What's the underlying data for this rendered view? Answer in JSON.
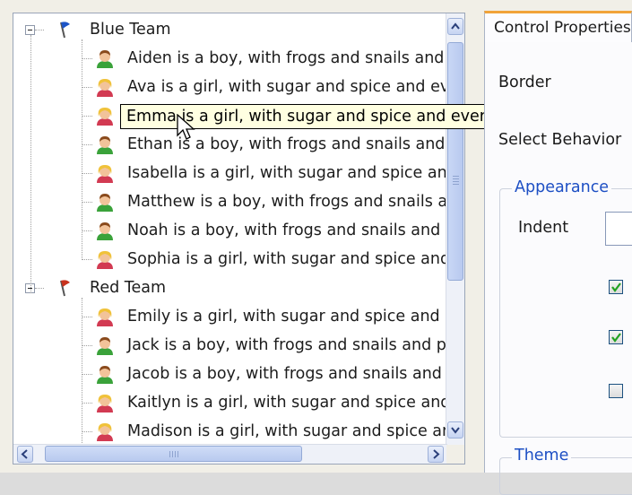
{
  "tree": {
    "nodes": [
      {
        "kind": "group",
        "label": "Blue Team",
        "flag": "blue"
      },
      {
        "kind": "child",
        "label": "Aiden is a boy, with frogs and snails and puppy dog tails.",
        "gender": "boy"
      },
      {
        "kind": "child",
        "label": "Ava is a girl, with sugar and spice and everything nice.",
        "gender": "girl"
      },
      {
        "kind": "child",
        "label": "Emma is a girl, with sugar and spice and everything nice.",
        "gender": "girl"
      },
      {
        "kind": "child",
        "label": "Ethan is a boy, with frogs and snails and puppy dog tails.",
        "gender": "boy"
      },
      {
        "kind": "child",
        "label": "Isabella is a girl, with sugar and spice and everything nice.",
        "gender": "girl"
      },
      {
        "kind": "child",
        "label": "Matthew is a boy, with frogs and snails and puppy dog tails.",
        "gender": "boy"
      },
      {
        "kind": "child",
        "label": "Noah is a boy, with frogs and snails and puppy dog tails.",
        "gender": "boy"
      },
      {
        "kind": "child",
        "label": "Sophia is a girl, with sugar and spice and everything nice.",
        "gender": "girl"
      },
      {
        "kind": "group",
        "label": "Red Team",
        "flag": "red"
      },
      {
        "kind": "child",
        "label": "Emily is a girl, with sugar and spice and everything nice.",
        "gender": "girl"
      },
      {
        "kind": "child",
        "label": "Jack is a boy, with frogs and snails and puppy dog tails.",
        "gender": "boy"
      },
      {
        "kind": "child",
        "label": "Jacob is a boy, with frogs and snails and puppy dog tails.",
        "gender": "boy"
      },
      {
        "kind": "child",
        "label": "Kaitlyn is a girl, with sugar and spice and everything nice.",
        "gender": "girl"
      },
      {
        "kind": "child",
        "label": "Madison is a girl, with sugar and spice and everything nice.",
        "gender": "girl"
      }
    ],
    "tooltip": "Emma is a girl, with sugar and spice and everything nice.",
    "colors": {
      "blue_flag": "#1d55c7",
      "red_flag": "#c8321e",
      "boy_shirt": "#3aa23a",
      "girl_shirt": "#d23a52"
    }
  },
  "panel": {
    "tab_label": "Control Properties",
    "border_label": "Border",
    "select_behavior_label": "Select Behavior",
    "appearance_legend": "Appearance",
    "indent_label": "Indent",
    "theme_legend": "Theme",
    "checkboxes": [
      true,
      true,
      false
    ]
  }
}
